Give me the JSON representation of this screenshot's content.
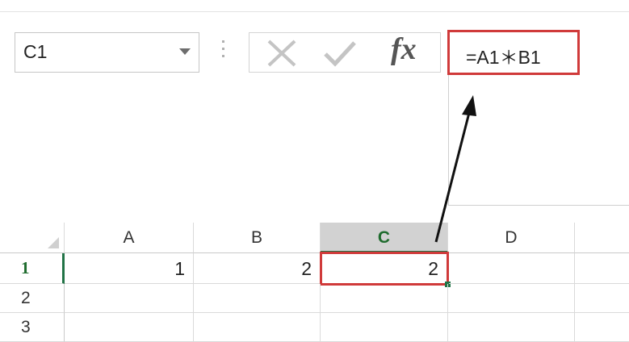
{
  "name_box": {
    "value": "C1"
  },
  "formula_bar": {
    "formula": "=A1＊B1",
    "fx_label": "fx"
  },
  "columns": [
    "A",
    "B",
    "C",
    "D"
  ],
  "selected_column": "C",
  "rows": [
    {
      "label": "1",
      "cells": [
        "1",
        "2",
        "2",
        ""
      ]
    },
    {
      "label": "2",
      "cells": [
        "",
        "",
        "",
        ""
      ]
    },
    {
      "label": "3",
      "cells": [
        "",
        "",
        "",
        ""
      ]
    }
  ],
  "colors": {
    "highlight_red": "#d03a3a",
    "excel_green": "#217346"
  },
  "icons": [
    "chevron-down-icon",
    "cancel-icon",
    "enter-check-icon",
    "fx-icon",
    "annotation-arrow-icon"
  ]
}
